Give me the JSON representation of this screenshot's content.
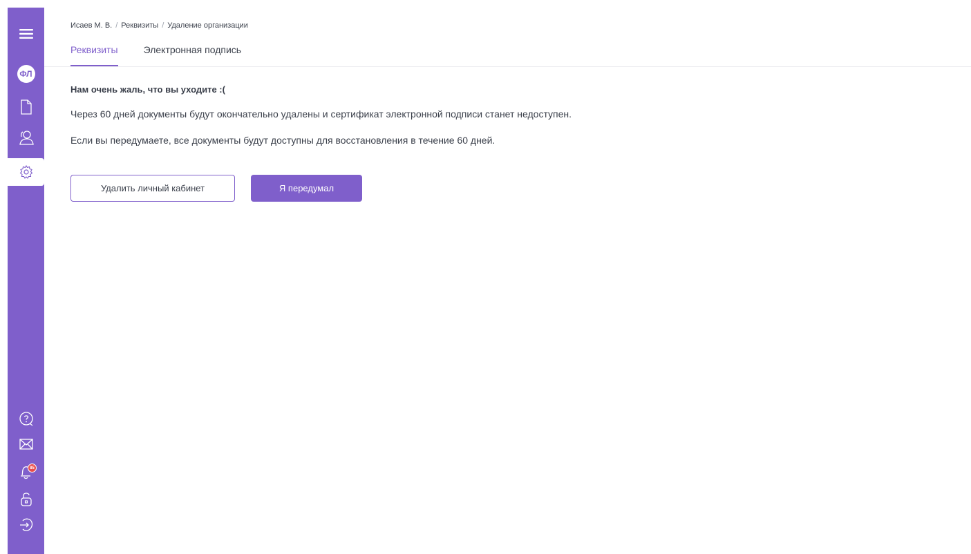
{
  "breadcrumb": {
    "items": [
      "Исаев М. В.",
      "Реквизиты",
      "Удаление организации"
    ],
    "separator": "/"
  },
  "tabs": [
    {
      "label": "Реквизиты",
      "active": true
    },
    {
      "label": "Электронная подпись",
      "active": false
    }
  ],
  "sidebar": {
    "avatar_initials": "ФЛ",
    "notification_count": "85",
    "items_top": [
      "menu-icon",
      "avatar",
      "document-icon",
      "user-icon",
      "settings-icon"
    ],
    "items_bottom": [
      "help-icon",
      "mail-icon",
      "bell-icon",
      "lock-icon",
      "logout-icon"
    ],
    "active": "settings-icon"
  },
  "content": {
    "heading": "Нам очень жаль, что вы уходите :(",
    "paragraph1": "Через 60 дней документы будут окончательно удалены и сертификат электронной подписи станет недоступен.",
    "paragraph2": "Если вы передумаете, все документы будут доступны для восстановления в течение  60 дней."
  },
  "buttons": {
    "delete_label": "Удалить личный кабинет",
    "cancel_label": "Я передумал"
  },
  "colors": {
    "accent": "#7f5fcb",
    "badge": "#e94b4b",
    "text": "#3a3f4a"
  }
}
